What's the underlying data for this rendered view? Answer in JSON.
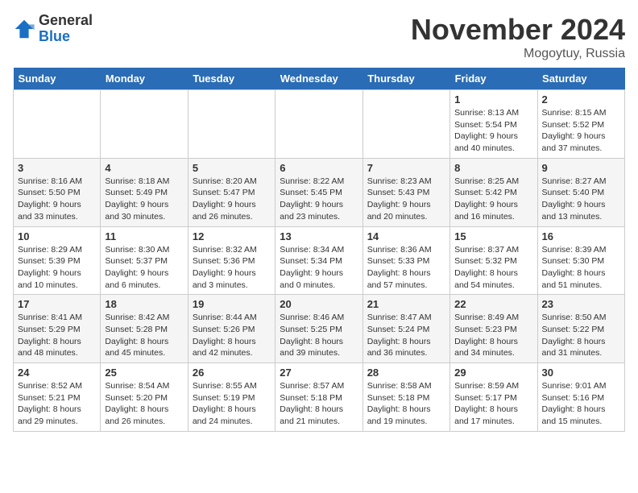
{
  "logo": {
    "general": "General",
    "blue": "Blue"
  },
  "header": {
    "month": "November 2024",
    "location": "Mogoytuy, Russia"
  },
  "weekdays": [
    "Sunday",
    "Monday",
    "Tuesday",
    "Wednesday",
    "Thursday",
    "Friday",
    "Saturday"
  ],
  "weeks": [
    [
      {
        "day": "",
        "info": ""
      },
      {
        "day": "",
        "info": ""
      },
      {
        "day": "",
        "info": ""
      },
      {
        "day": "",
        "info": ""
      },
      {
        "day": "",
        "info": ""
      },
      {
        "day": "1",
        "info": "Sunrise: 8:13 AM\nSunset: 5:54 PM\nDaylight: 9 hours\nand 40 minutes."
      },
      {
        "day": "2",
        "info": "Sunrise: 8:15 AM\nSunset: 5:52 PM\nDaylight: 9 hours\nand 37 minutes."
      }
    ],
    [
      {
        "day": "3",
        "info": "Sunrise: 8:16 AM\nSunset: 5:50 PM\nDaylight: 9 hours\nand 33 minutes."
      },
      {
        "day": "4",
        "info": "Sunrise: 8:18 AM\nSunset: 5:49 PM\nDaylight: 9 hours\nand 30 minutes."
      },
      {
        "day": "5",
        "info": "Sunrise: 8:20 AM\nSunset: 5:47 PM\nDaylight: 9 hours\nand 26 minutes."
      },
      {
        "day": "6",
        "info": "Sunrise: 8:22 AM\nSunset: 5:45 PM\nDaylight: 9 hours\nand 23 minutes."
      },
      {
        "day": "7",
        "info": "Sunrise: 8:23 AM\nSunset: 5:43 PM\nDaylight: 9 hours\nand 20 minutes."
      },
      {
        "day": "8",
        "info": "Sunrise: 8:25 AM\nSunset: 5:42 PM\nDaylight: 9 hours\nand 16 minutes."
      },
      {
        "day": "9",
        "info": "Sunrise: 8:27 AM\nSunset: 5:40 PM\nDaylight: 9 hours\nand 13 minutes."
      }
    ],
    [
      {
        "day": "10",
        "info": "Sunrise: 8:29 AM\nSunset: 5:39 PM\nDaylight: 9 hours\nand 10 minutes."
      },
      {
        "day": "11",
        "info": "Sunrise: 8:30 AM\nSunset: 5:37 PM\nDaylight: 9 hours\nand 6 minutes."
      },
      {
        "day": "12",
        "info": "Sunrise: 8:32 AM\nSunset: 5:36 PM\nDaylight: 9 hours\nand 3 minutes."
      },
      {
        "day": "13",
        "info": "Sunrise: 8:34 AM\nSunset: 5:34 PM\nDaylight: 9 hours\nand 0 minutes."
      },
      {
        "day": "14",
        "info": "Sunrise: 8:36 AM\nSunset: 5:33 PM\nDaylight: 8 hours\nand 57 minutes."
      },
      {
        "day": "15",
        "info": "Sunrise: 8:37 AM\nSunset: 5:32 PM\nDaylight: 8 hours\nand 54 minutes."
      },
      {
        "day": "16",
        "info": "Sunrise: 8:39 AM\nSunset: 5:30 PM\nDaylight: 8 hours\nand 51 minutes."
      }
    ],
    [
      {
        "day": "17",
        "info": "Sunrise: 8:41 AM\nSunset: 5:29 PM\nDaylight: 8 hours\nand 48 minutes."
      },
      {
        "day": "18",
        "info": "Sunrise: 8:42 AM\nSunset: 5:28 PM\nDaylight: 8 hours\nand 45 minutes."
      },
      {
        "day": "19",
        "info": "Sunrise: 8:44 AM\nSunset: 5:26 PM\nDaylight: 8 hours\nand 42 minutes."
      },
      {
        "day": "20",
        "info": "Sunrise: 8:46 AM\nSunset: 5:25 PM\nDaylight: 8 hours\nand 39 minutes."
      },
      {
        "day": "21",
        "info": "Sunrise: 8:47 AM\nSunset: 5:24 PM\nDaylight: 8 hours\nand 36 minutes."
      },
      {
        "day": "22",
        "info": "Sunrise: 8:49 AM\nSunset: 5:23 PM\nDaylight: 8 hours\nand 34 minutes."
      },
      {
        "day": "23",
        "info": "Sunrise: 8:50 AM\nSunset: 5:22 PM\nDaylight: 8 hours\nand 31 minutes."
      }
    ],
    [
      {
        "day": "24",
        "info": "Sunrise: 8:52 AM\nSunset: 5:21 PM\nDaylight: 8 hours\nand 29 minutes."
      },
      {
        "day": "25",
        "info": "Sunrise: 8:54 AM\nSunset: 5:20 PM\nDaylight: 8 hours\nand 26 minutes."
      },
      {
        "day": "26",
        "info": "Sunrise: 8:55 AM\nSunset: 5:19 PM\nDaylight: 8 hours\nand 24 minutes."
      },
      {
        "day": "27",
        "info": "Sunrise: 8:57 AM\nSunset: 5:18 PM\nDaylight: 8 hours\nand 21 minutes."
      },
      {
        "day": "28",
        "info": "Sunrise: 8:58 AM\nSunset: 5:18 PM\nDaylight: 8 hours\nand 19 minutes."
      },
      {
        "day": "29",
        "info": "Sunrise: 8:59 AM\nSunset: 5:17 PM\nDaylight: 8 hours\nand 17 minutes."
      },
      {
        "day": "30",
        "info": "Sunrise: 9:01 AM\nSunset: 5:16 PM\nDaylight: 8 hours\nand 15 minutes."
      }
    ]
  ]
}
